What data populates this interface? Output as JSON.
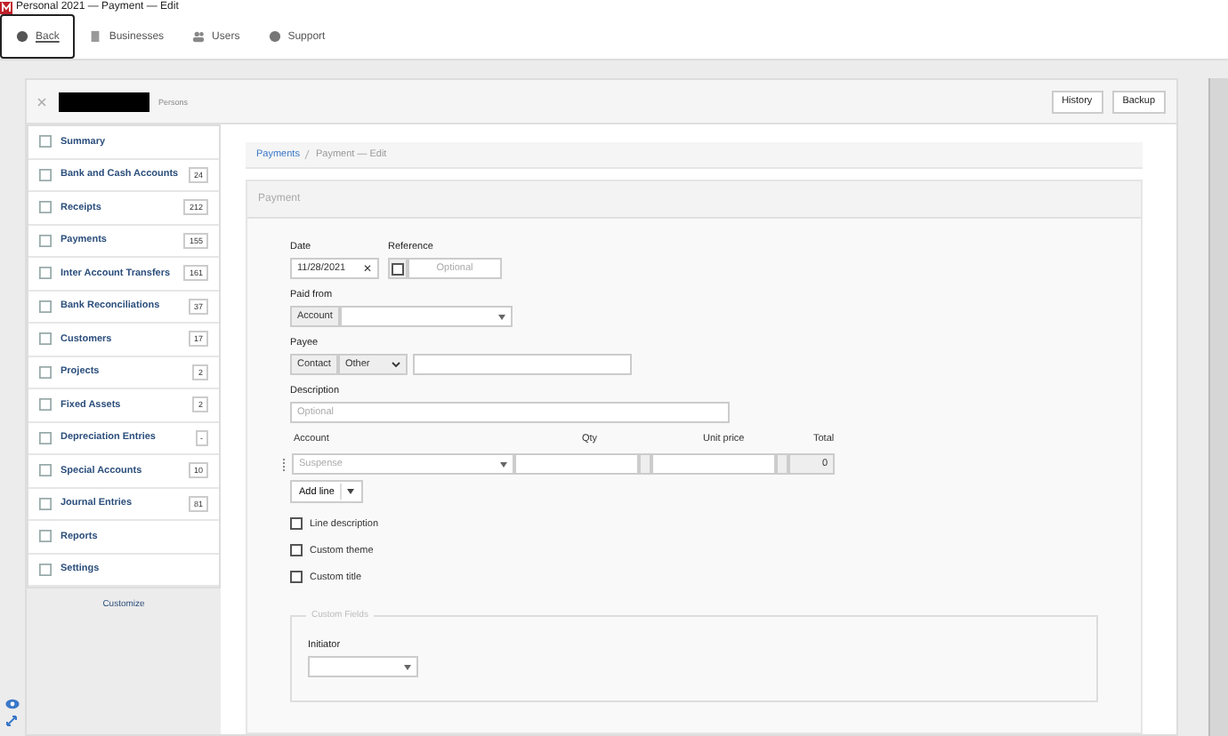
{
  "window": {
    "title": "Personal 2021 — Payment — Edit"
  },
  "nav": [
    {
      "label": "Back",
      "selected": true
    },
    {
      "label": "Businesses",
      "selected": false
    },
    {
      "label": "Users",
      "selected": false
    },
    {
      "label": "Support",
      "selected": false
    }
  ],
  "business": {
    "name": "Persons",
    "actions": [
      "History",
      "Backup"
    ]
  },
  "sidebar": {
    "items": [
      {
        "label": "Summary"
      },
      {
        "label": "Bank and Cash Accounts",
        "count": "24"
      },
      {
        "label": "Receipts",
        "count": "212"
      },
      {
        "label": "Payments",
        "count": "155"
      },
      {
        "label": "Inter Account Transfers",
        "count": "161"
      },
      {
        "label": "Bank Reconciliations",
        "count": "37"
      },
      {
        "label": "Customers",
        "count": "17"
      },
      {
        "label": "Projects",
        "count": "2"
      },
      {
        "label": "Fixed Assets",
        "count": "2"
      },
      {
        "label": "Depreciation Entries",
        "count": "-"
      },
      {
        "label": "Special Accounts",
        "count": "10"
      },
      {
        "label": "Journal Entries",
        "count": "81"
      },
      {
        "label": "Reports"
      },
      {
        "label": "Settings"
      }
    ],
    "customize": "Customize"
  },
  "breadcrumb": [
    "Payments",
    "Payment — Edit"
  ],
  "form": {
    "title": "Payment",
    "date": {
      "label": "Date",
      "value": "11/28/2021",
      "clear": "✕"
    },
    "reference": {
      "label": "Reference",
      "checked": false,
      "placeholder": "Optional"
    },
    "paid_from": {
      "label": "Paid from",
      "addon": "Account"
    },
    "payee": {
      "label": "Payee",
      "addon": "Contact",
      "select": "Other"
    },
    "description": {
      "label": "Description",
      "placeholder": "Optional"
    },
    "lines": {
      "columns": [
        "Account",
        "Qty",
        "Unit price",
        "Total"
      ],
      "account_placeholder": "Suspense",
      "total": "0",
      "add": "Add line"
    },
    "options": [
      {
        "label": "Line description",
        "checked": false
      },
      {
        "label": "Custom theme",
        "checked": false
      },
      {
        "label": "Custom title",
        "checked": false
      }
    ],
    "custom_fields": {
      "legend": "Custom Fields",
      "field": "Initiator"
    }
  }
}
